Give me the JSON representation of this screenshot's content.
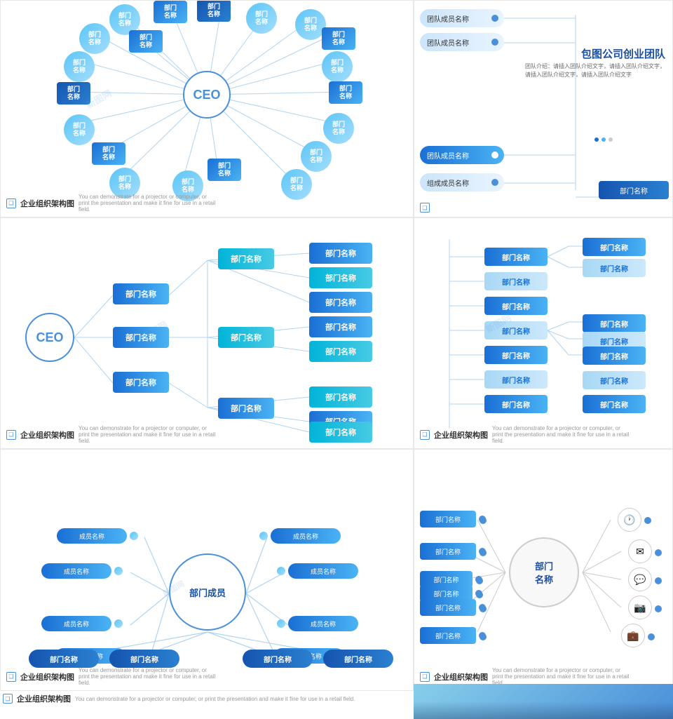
{
  "panel1": {
    "label": "企业组织架构图",
    "desc": "You can demonstrate for a projector or computer, or print the presentation and make it fine for use in a retail field.",
    "ceo": "CEO",
    "nodes": [
      "部门\n名称",
      "部门\n名称",
      "部门\n名称",
      "部门\n名称",
      "部门\n名称",
      "部门\n名称",
      "部门\n名称",
      "部门\n名称",
      "部门\n名称",
      "部门\n名称",
      "部门\n名称",
      "部门\n名称",
      "部门\n名称",
      "部门\n名称",
      "部门\n名称",
      "部门\n名称",
      "部门\n名称",
      "部门\n名称",
      "部门\n名称",
      "部门\n名称"
    ]
  },
  "panel2": {
    "title": "包图公司创业团队",
    "desc": "团队介绍：请插入团队介绍文字，请插入团队介绍文字，请插入团队介绍文字，请插入团队介绍文字",
    "members": [
      "团队成员名称",
      "团队成员名称",
      "团队成员名称",
      "组成成员名称"
    ],
    "dept": "部门名称",
    "dots": [
      "#1a6fd4",
      "#4ab3f4",
      "#ccc"
    ]
  },
  "panel3": {
    "label": "企业组织架构图",
    "desc": "You can demonstrate for a projector or computer, or print the presentation and make it fine for use in a retail field.",
    "ceo": "CEO",
    "dept1": "部门名称",
    "dept2": "部门名称",
    "dept3": "部门名称",
    "sub_nodes": [
      "部门名称",
      "部门名称",
      "部门名称",
      "部门名称",
      "部门名称",
      "部门名称",
      "部门名称",
      "部门名称",
      "部门名称",
      "部门名称",
      "部门名称"
    ]
  },
  "panel4": {
    "label": "企业组织架构图",
    "desc": "You can demonstrate for a projector or computer, or print the presentation and make it fine for use in a retail field.",
    "nodes": [
      "部门名称",
      "部门名称",
      "部门名称",
      "部门名称",
      "部门名称",
      "部门名称",
      "部门名称",
      "部门名称",
      "部门名称",
      "部门名称",
      "部门名称",
      "部门名称",
      "部门名称",
      "部门名称"
    ]
  },
  "panel5": {
    "label": "企业组织架构图",
    "desc": "You can demonstrate for a projector or computer, or print the presentation and make it fine for use in a retail field.",
    "center": "部门成员",
    "members": [
      "成员名称",
      "成员名称",
      "成员名称",
      "成员名称",
      "成员名称",
      "成员名称",
      "成员名称",
      "成员名称"
    ],
    "depts": [
      "部门名称",
      "部门名称",
      "部门名称",
      "部门名称"
    ]
  },
  "panel6": {
    "label": "企业组织架构图",
    "desc": "You can demonstrate for a projector or computer, or print the presentation and make it fine for use in a retail field.",
    "center": "部门\n名称",
    "bars": [
      "部门名称",
      "部门名称",
      "部门名称",
      "部门名称",
      "部门名称",
      "部门名称"
    ],
    "icons": [
      "🕐",
      "✉",
      "💬",
      "📷",
      "💼"
    ]
  }
}
